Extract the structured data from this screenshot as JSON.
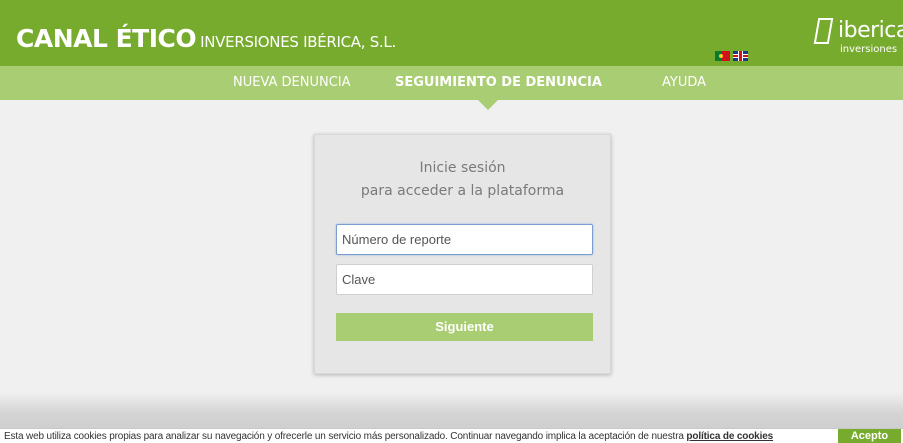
{
  "header": {
    "brand_main": "CANAL ÉTICO",
    "brand_sub": "INVERSIONES IBÉRICA, S.L.",
    "logo_word": "iberica",
    "logo_sub": "inversiones"
  },
  "nav": {
    "items": [
      {
        "label": "NUEVA DENUNCIA"
      },
      {
        "label": "SEGUIMIENTO DE DENUNCIA"
      },
      {
        "label": "AYUDA"
      }
    ]
  },
  "login": {
    "title_line1": "Inicie sesión",
    "title_line2": "para acceder a la plataforma",
    "report_placeholder": "Número de reporte",
    "key_placeholder": "Clave",
    "submit_label": "Siguiente"
  },
  "cookies": {
    "text": "Esta web utiliza cookies propias para analizar su navegación y ofrecerle un servicio más personalizado. Continuar navegando implica la aceptación de nuestra ",
    "link": "política de cookies",
    "accept": "Acepto"
  },
  "colors": {
    "header_green": "#77ab2e",
    "nav_green": "#a9cd73"
  }
}
